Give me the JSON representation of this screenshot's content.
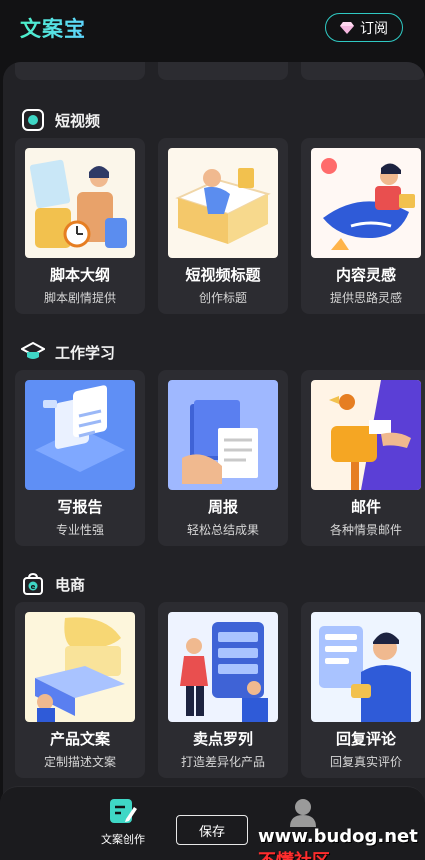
{
  "app": {
    "logo_text": "文案宝"
  },
  "header": {
    "subscribe_label": "订阅",
    "subscribe_icon": "diamond-icon"
  },
  "sections": [
    {
      "title": "短视频",
      "icon": "camera-icon",
      "cards": [
        {
          "name": "脚本大纲",
          "desc": "脚本剧情提供",
          "icon": "script-illustration"
        },
        {
          "name": "短视频标题",
          "desc": "创作标题",
          "icon": "book-illustration"
        },
        {
          "name": "内容灵感",
          "desc": "提供思路灵感",
          "icon": "rocket-illustration"
        }
      ]
    },
    {
      "title": "工作学习",
      "icon": "graduation-cap-icon",
      "cards": [
        {
          "name": "写报告",
          "desc": "专业性强",
          "icon": "report-illustration"
        },
        {
          "name": "周报",
          "desc": "轻松总结成果",
          "icon": "weekly-report-illustration"
        },
        {
          "name": "邮件",
          "desc": "各种情景邮件",
          "icon": "mailbox-illustration"
        }
      ]
    },
    {
      "title": "电商",
      "icon": "shopping-bag-icon",
      "cards": [
        {
          "name": "产品文案",
          "desc": "定制描述文案",
          "icon": "product-illustration"
        },
        {
          "name": "卖点罗列",
          "desc": "打造差异化产品",
          "icon": "selling-points-illustration"
        },
        {
          "name": "回复评论",
          "desc": "回复真实评价",
          "icon": "reply-illustration"
        }
      ]
    }
  ],
  "bottom_nav": {
    "create_label": "文案创作",
    "save_label": "保存",
    "mine_icon": "user-icon"
  },
  "watermark": {
    "url": "www.budog.net",
    "name": "不懂社区"
  },
  "colors": {
    "accent": "#2fc9c3",
    "background": "#121214",
    "panel": "#222226",
    "card": "#2c2c31"
  }
}
